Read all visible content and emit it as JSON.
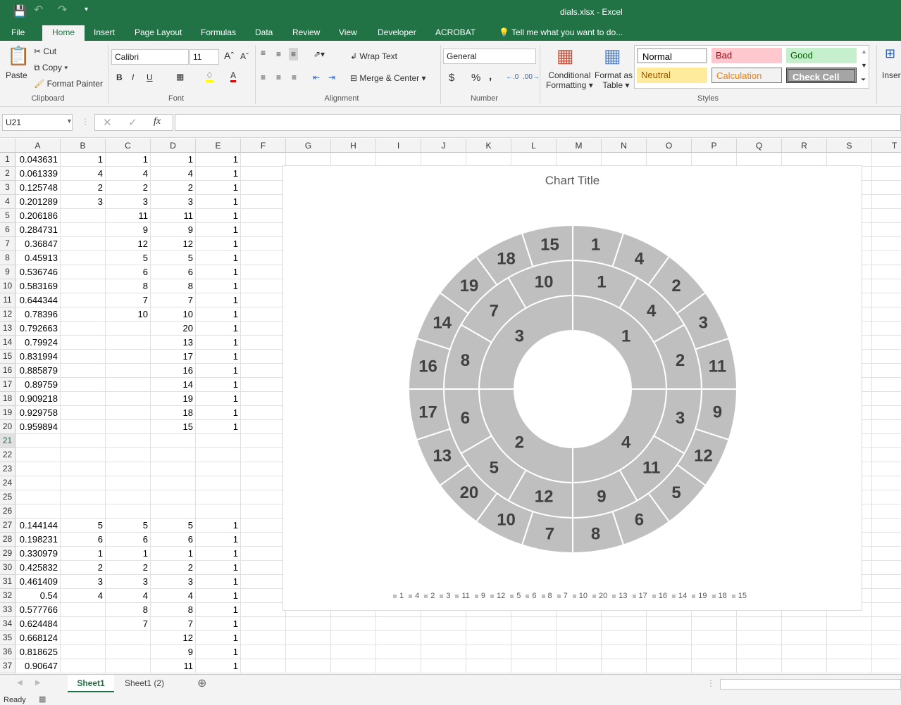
{
  "app": {
    "title": "dials.xlsx - Excel"
  },
  "ribbon_tabs": [
    "File",
    "Home",
    "Insert",
    "Page Layout",
    "Formulas",
    "Data",
    "Review",
    "View",
    "Developer",
    "ACROBAT"
  ],
  "tell_me": "Tell me what you want to do...",
  "clipboard": {
    "paste": "Paste",
    "cut": "Cut",
    "copy": "Copy",
    "format_painter": "Format Painter",
    "group": "Clipboard"
  },
  "font": {
    "name": "Calibri",
    "size": "11",
    "bold": "B",
    "italic": "I",
    "underline": "U",
    "group": "Font"
  },
  "alignment": {
    "wrap": "Wrap Text",
    "merge": "Merge & Center",
    "group": "Alignment"
  },
  "number": {
    "format": "General",
    "currency": "$",
    "percent": "%",
    "comma": ",",
    "group": "Number"
  },
  "styles": {
    "conditional": "Conditional",
    "conditional2": "Formatting",
    "format_table": "Format as",
    "format_table2": "Table",
    "group": "Styles",
    "cells": [
      {
        "label": "Normal",
        "bg": "#ffffff",
        "fg": "#000000"
      },
      {
        "label": "Bad",
        "bg": "#ffc7ce",
        "fg": "#9c0006"
      },
      {
        "label": "Good",
        "bg": "#c6efce",
        "fg": "#006100"
      },
      {
        "label": "Neutral",
        "bg": "#ffeb9c",
        "fg": "#9c5700"
      },
      {
        "label": "Calculation",
        "bg": "#f2f2f2",
        "fg": "#fa7d00"
      },
      {
        "label": "Check Cell",
        "bg": "#a5a5a5",
        "fg": "#ffffff"
      }
    ]
  },
  "cells_group": {
    "insert": "Inser"
  },
  "formula_bar": {
    "name_box": "U21",
    "fx": "fx",
    "value": ""
  },
  "columns": [
    "A",
    "B",
    "C",
    "D",
    "E",
    "F",
    "G",
    "H",
    "I",
    "J",
    "K",
    "L",
    "M",
    "N",
    "O",
    "P",
    "Q",
    "R",
    "S",
    "T"
  ],
  "rows": [
    [
      "1",
      "0.043631",
      "1",
      "1",
      "1",
      "1"
    ],
    [
      "2",
      "0.061339",
      "4",
      "4",
      "4",
      "1"
    ],
    [
      "3",
      "0.125748",
      "2",
      "2",
      "2",
      "1"
    ],
    [
      "4",
      "0.201289",
      "3",
      "3",
      "3",
      "1"
    ],
    [
      "5",
      "0.206186",
      "",
      "11",
      "11",
      "1"
    ],
    [
      "6",
      "0.284731",
      "",
      "9",
      "9",
      "1"
    ],
    [
      "7",
      "0.36847",
      "",
      "12",
      "12",
      "1"
    ],
    [
      "8",
      "0.45913",
      "",
      "5",
      "5",
      "1"
    ],
    [
      "9",
      "0.536746",
      "",
      "6",
      "6",
      "1"
    ],
    [
      "10",
      "0.583169",
      "",
      "8",
      "8",
      "1"
    ],
    [
      "11",
      "0.644344",
      "",
      "7",
      "7",
      "1"
    ],
    [
      "12",
      "0.78396",
      "",
      "10",
      "10",
      "1"
    ],
    [
      "13",
      "0.792663",
      "",
      "",
      "20",
      "1"
    ],
    [
      "14",
      "0.79924",
      "",
      "",
      "13",
      "1"
    ],
    [
      "15",
      "0.831994",
      "",
      "",
      "17",
      "1"
    ],
    [
      "16",
      "0.885879",
      "",
      "",
      "16",
      "1"
    ],
    [
      "17",
      "0.89759",
      "",
      "",
      "14",
      "1"
    ],
    [
      "18",
      "0.909218",
      "",
      "",
      "19",
      "1"
    ],
    [
      "19",
      "0.929758",
      "",
      "",
      "18",
      "1"
    ],
    [
      "20",
      "0.959894",
      "",
      "",
      "15",
      "1"
    ],
    [
      "21",
      "",
      "",
      "",
      "",
      ""
    ],
    [
      "22",
      "",
      "",
      "",
      "",
      ""
    ],
    [
      "23",
      "",
      "",
      "",
      "",
      ""
    ],
    [
      "24",
      "",
      "",
      "",
      "",
      ""
    ],
    [
      "25",
      "",
      "",
      "",
      "",
      ""
    ],
    [
      "26",
      "",
      "",
      "",
      "",
      ""
    ],
    [
      "27",
      "0.144144",
      "5",
      "5",
      "5",
      "1"
    ],
    [
      "28",
      "0.198231",
      "6",
      "6",
      "6",
      "1"
    ],
    [
      "29",
      "0.330979",
      "1",
      "1",
      "1",
      "1"
    ],
    [
      "30",
      "0.425832",
      "2",
      "2",
      "2",
      "1"
    ],
    [
      "31",
      "0.461409",
      "3",
      "3",
      "3",
      "1"
    ],
    [
      "32",
      "0.54",
      "4",
      "4",
      "4",
      "1"
    ],
    [
      "33",
      "0.577766",
      "",
      "8",
      "8",
      "1"
    ],
    [
      "34",
      "0.624484",
      "",
      "7",
      "7",
      "1"
    ],
    [
      "35",
      "0.668124",
      "",
      "",
      "12",
      "1"
    ],
    [
      "36",
      "0.818625",
      "",
      "",
      "9",
      "1"
    ],
    [
      "37",
      "0.90647",
      "",
      "",
      "11",
      "1"
    ]
  ],
  "selected_row": "21",
  "chart_data": {
    "type": "doughnut",
    "title": "Chart Title",
    "slice_color": "#bfbfbf",
    "label_color": "#404040",
    "rings": [
      {
        "labels": [
          1,
          4,
          2,
          3
        ],
        "values": [
          1,
          1,
          1,
          1
        ]
      },
      {
        "labels": [
          1,
          4,
          2,
          3,
          11,
          9,
          12,
          5,
          6,
          8,
          7,
          10
        ],
        "values": [
          1,
          1,
          1,
          1,
          1,
          1,
          1,
          1,
          1,
          1,
          1,
          1
        ]
      },
      {
        "labels": [
          1,
          4,
          2,
          3,
          11,
          9,
          12,
          5,
          6,
          8,
          7,
          10,
          20,
          13,
          17,
          16,
          14,
          19,
          18,
          15
        ],
        "values": [
          1,
          1,
          1,
          1,
          1,
          1,
          1,
          1,
          1,
          1,
          1,
          1,
          1,
          1,
          1,
          1,
          1,
          1,
          1,
          1
        ]
      }
    ],
    "legend": [
      "1",
      "4",
      "2",
      "3",
      "11",
      "9",
      "12",
      "5",
      "6",
      "8",
      "7",
      "10",
      "20",
      "13",
      "17",
      "16",
      "14",
      "19",
      "18",
      "15"
    ],
    "legend_position": "bottom"
  },
  "sheets": [
    {
      "label": "Sheet1",
      "active": true
    },
    {
      "label": "Sheet1 (2)",
      "active": false
    }
  ],
  "status": "Ready"
}
